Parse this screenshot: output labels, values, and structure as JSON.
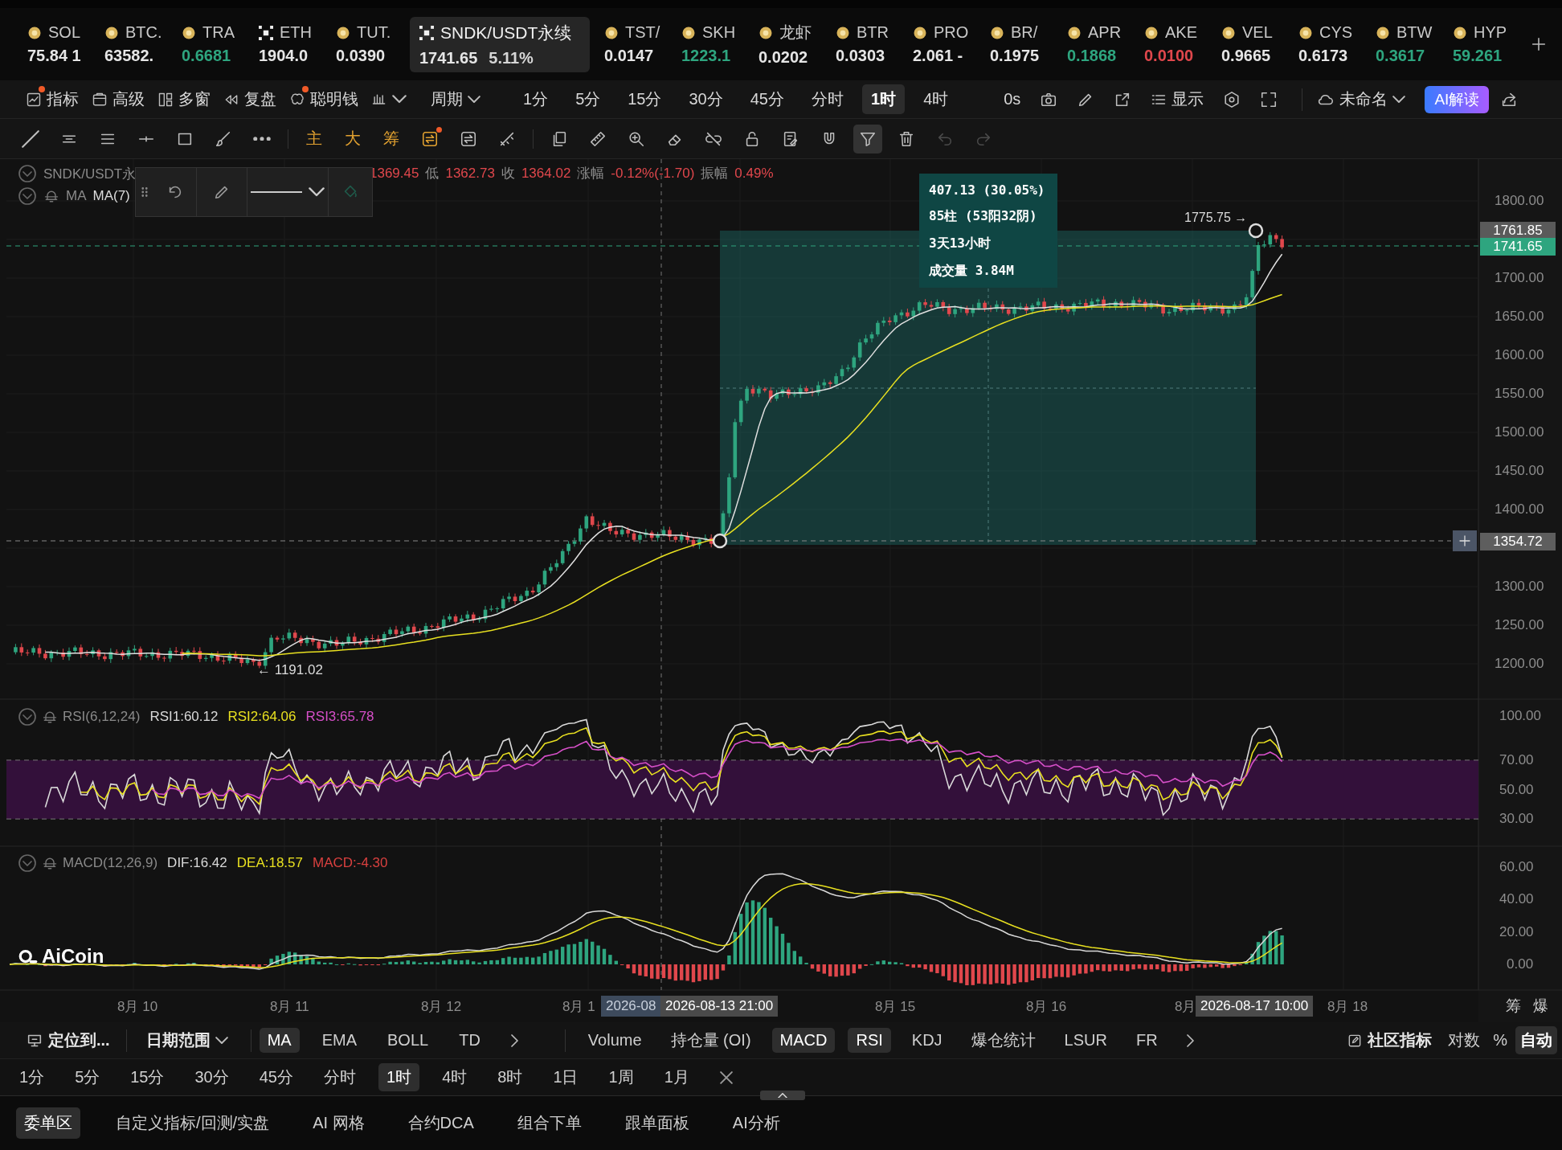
{
  "tickers": [
    {
      "symbol": "SOL",
      "price": "75.84 1",
      "color": "#e6e6e6",
      "kind": "coin",
      "selected": false
    },
    {
      "symbol": "BTC.",
      "price": "63582.",
      "color": "#e6e6e6",
      "kind": "coin",
      "selected": false
    },
    {
      "symbol": "TRA",
      "price": "0.6681",
      "color": "#2ea57f",
      "kind": "coin",
      "selected": false
    },
    {
      "symbol": "ETH",
      "price": "1904.0",
      "color": "#e6e6e6",
      "kind": "cross",
      "selected": false
    },
    {
      "symbol": "TUT.",
      "price": "0.0390",
      "color": "#e6e6e6",
      "kind": "coin",
      "selected": false
    },
    {
      "symbol": "SNDK/USDT永续",
      "price": "1741.65",
      "percent": "5.11%",
      "color": "#e6e6e6",
      "kind": "cross",
      "selected": true
    },
    {
      "symbol": "TST/",
      "price": "0.0147",
      "color": "#e6e6e6",
      "kind": "coin",
      "selected": false
    },
    {
      "symbol": "SKH",
      "price": "1223.1",
      "color": "#2ea57f",
      "kind": "coin",
      "selected": false
    },
    {
      "symbol": "龙虾",
      "price": "0.0202",
      "color": "#e6e6e6",
      "kind": "coin",
      "selected": false
    },
    {
      "symbol": "BTR",
      "price": "0.0303",
      "color": "#e6e6e6",
      "kind": "coin",
      "selected": false
    },
    {
      "symbol": "PRO",
      "price": "2.061 -",
      "color": "#e6e6e6",
      "kind": "coin",
      "selected": false
    },
    {
      "symbol": "BR/",
      "price": "0.1975",
      "color": "#e6e6e6",
      "kind": "coin",
      "selected": false
    },
    {
      "symbol": "APR",
      "price": "0.1868",
      "color": "#2ea57f",
      "kind": "coin",
      "selected": false
    },
    {
      "symbol": "AKE",
      "price": "0.0100",
      "color": "#e0474c",
      "kind": "coin",
      "selected": false
    },
    {
      "symbol": "VEL",
      "price": "0.9665",
      "color": "#e6e6e6",
      "kind": "coin",
      "selected": false
    },
    {
      "symbol": "CYS",
      "price": "0.6173",
      "color": "#e6e6e6",
      "kind": "coin",
      "selected": false
    },
    {
      "symbol": "BTW",
      "price": "0.3617",
      "color": "#2ea57f",
      "kind": "coin",
      "selected": false
    },
    {
      "symbol": "HYP",
      "price": "59.261",
      "color": "#2ea57f",
      "kind": "coin",
      "selected": false
    }
  ],
  "toolbar": {
    "tools": [
      {
        "label": "指标",
        "dot": true
      },
      {
        "label": "高级",
        "dot": false
      },
      {
        "label": "多窗",
        "dot": false
      },
      {
        "label": "复盘",
        "dot": false
      },
      {
        "label": "聪明钱",
        "dot": true
      }
    ],
    "period_label": "周期",
    "periods": [
      {
        "label": "1分",
        "selected": false
      },
      {
        "label": "5分",
        "selected": false
      },
      {
        "label": "15分",
        "selected": false
      },
      {
        "label": "30分",
        "selected": false
      },
      {
        "label": "45分",
        "selected": false
      },
      {
        "label": "分时",
        "selected": false
      },
      {
        "label": "1时",
        "selected": true
      },
      {
        "label": "4时",
        "selected": false
      }
    ],
    "refresh": "0s",
    "display_label": "显示",
    "layout_name": "未命名",
    "ai_button": "AI解读"
  },
  "drawing_tools": {
    "marks": [
      "主",
      "大",
      "筹"
    ],
    "filter_active": true,
    "undo_disabled": true,
    "redo_disabled": true
  },
  "chart": {
    "symbol": "SNDK/USDT永",
    "ohlc": [
      {
        "value": "1369.45"
      },
      {
        "label": "低",
        "value": "1362.73"
      },
      {
        "label": "收",
        "value": "1364.02"
      },
      {
        "label": "涨幅",
        "value": "-0.12%(-1.70)"
      },
      {
        "label": "振幅",
        "value": "0.49%"
      }
    ],
    "ma_legend": {
      "label": "MA",
      "params": "MA(7)"
    },
    "measure": [
      "407.13 (30.05%)",
      "85柱 (53阳32阴)",
      "3天13小时",
      "成交量 3.84M"
    ],
    "high_label": "1775.75 →",
    "low_label": "← 1191.02",
    "price_axis": [
      "1800.00",
      "1700.00",
      "1650.00",
      "1600.00",
      "1550.00",
      "1500.00",
      "1450.00",
      "1400.00",
      "1300.00",
      "1250.00",
      "1200.00"
    ],
    "price_tags": [
      {
        "text": "1761.85",
        "kind": "high"
      },
      {
        "text": "1741.65",
        "kind": "last"
      },
      {
        "text": "1354.72",
        "kind": "cursor"
      }
    ],
    "rsi": {
      "title": "RSI(6,12,24)",
      "values": [
        {
          "text": "RSI1:60.12",
          "color": "#d9d9d9"
        },
        {
          "text": "RSI2:64.06",
          "color": "#e8e020"
        },
        {
          "text": "RSI3:65.78",
          "color": "#d64fc8"
        }
      ],
      "axis": [
        "100.00",
        "70.00",
        "50.00",
        "30.00"
      ]
    },
    "macd": {
      "title": "MACD(12,26,9)",
      "values": [
        {
          "text": "DIF:16.42",
          "color": "#d9d9d9"
        },
        {
          "text": "DEA:18.57",
          "color": "#e8e020"
        },
        {
          "text": "MACD:-4.30",
          "color": "#d9403f"
        }
      ],
      "axis": [
        "60.00",
        "40.00",
        "20.00",
        "0.00"
      ]
    },
    "logo": "AiCoin",
    "time_axis": [
      {
        "text": "8月 10",
        "kind": "date"
      },
      {
        "text": "8月 11",
        "kind": "date"
      },
      {
        "text": "8月 12",
        "kind": "date"
      },
      {
        "text": "8月 1",
        "kind": "date"
      },
      {
        "text": "2026-08",
        "kind": "range"
      },
      {
        "text": "2026-08-13 21:00",
        "kind": "cursor"
      },
      {
        "text": "8月 15",
        "kind": "date"
      },
      {
        "text": "8月 16",
        "kind": "date"
      },
      {
        "text": "8月",
        "kind": "date"
      },
      {
        "text": "2026-08-17 10:00",
        "kind": "cursor"
      },
      {
        "text": "8月 18",
        "kind": "date"
      }
    ],
    "side_labels": [
      "筹",
      "爆"
    ]
  },
  "indicator_bar": {
    "locate": "定位到...",
    "date_range": "日期范围",
    "main": [
      {
        "label": "MA",
        "selected": true
      },
      {
        "label": "EMA",
        "selected": false
      },
      {
        "label": "BOLL",
        "selected": false
      },
      {
        "label": "TD",
        "selected": false
      }
    ],
    "sub": [
      {
        "label": "Volume",
        "selected": false
      },
      {
        "label": "持仓量 (OI)",
        "selected": false
      },
      {
        "label": "MACD",
        "selected": true
      },
      {
        "label": "RSI",
        "selected": true
      },
      {
        "label": "KDJ",
        "selected": false
      },
      {
        "label": "爆仓统计",
        "selected": false
      },
      {
        "label": "LSUR",
        "selected": false
      },
      {
        "label": "FR",
        "selected": false
      }
    ],
    "community": "社区指标",
    "scale": [
      {
        "label": "对数",
        "selected": false
      },
      {
        "label": "%",
        "selected": false
      },
      {
        "label": "自动",
        "selected": true
      }
    ]
  },
  "periods": [
    {
      "label": "1分",
      "selected": false
    },
    {
      "label": "5分",
      "selected": false
    },
    {
      "label": "15分",
      "selected": false
    },
    {
      "label": "30分",
      "selected": false
    },
    {
      "label": "45分",
      "selected": false
    },
    {
      "label": "分时",
      "selected": false
    },
    {
      "label": "1时",
      "selected": true
    },
    {
      "label": "4时",
      "selected": false
    },
    {
      "label": "8时",
      "selected": false
    },
    {
      "label": "1日",
      "selected": false
    },
    {
      "label": "1周",
      "selected": false
    },
    {
      "label": "1月",
      "selected": false
    }
  ],
  "tabs": [
    {
      "label": "委单区",
      "selected": true
    },
    {
      "label": "自定义指标/回测/实盘",
      "selected": false
    },
    {
      "label": "AI 网格",
      "selected": false
    },
    {
      "label": "合约DCA",
      "selected": false
    },
    {
      "label": "组合下单",
      "selected": false
    },
    {
      "label": "跟单面板",
      "selected": false
    },
    {
      "label": "AI分析",
      "selected": false
    }
  ]
}
